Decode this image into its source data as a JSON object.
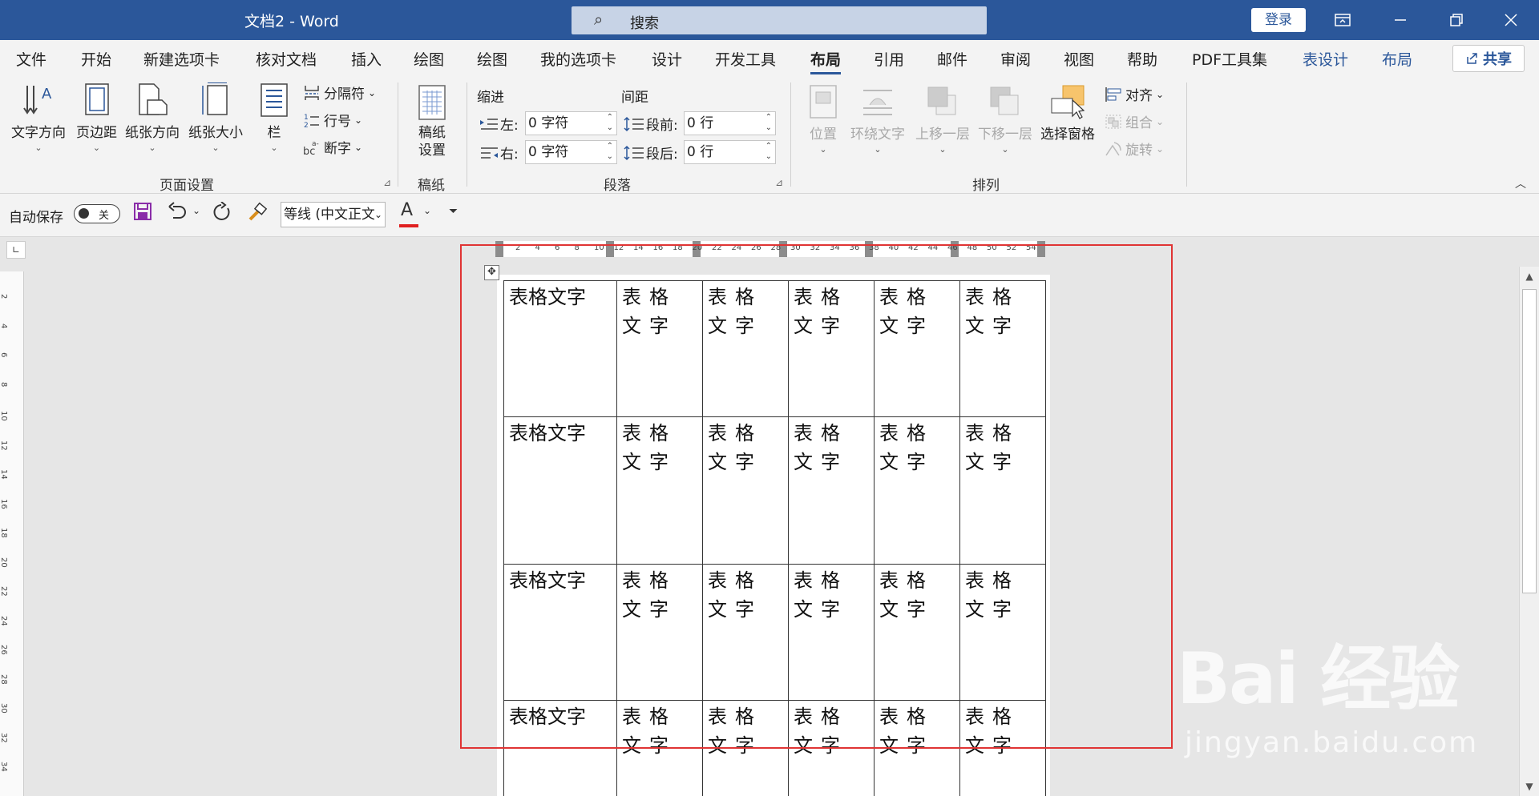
{
  "titlebar": {
    "title": "文档2  -  Word",
    "search_placeholder": "搜索",
    "login": "登录",
    "icons": [
      "ribbon-display-icon",
      "minimize-icon",
      "restore-icon",
      "close-icon"
    ]
  },
  "tabs": [
    "文件",
    "开始",
    "新建选项卡",
    "核对文档",
    "插入",
    "绘图",
    "绘图",
    "我的选项卡",
    "设计",
    "开发工具",
    "布局",
    "引用",
    "邮件",
    "审阅",
    "视图",
    "帮助",
    "PDF工具集",
    "表设计",
    "布局"
  ],
  "active_tab": "布局",
  "share": "共享",
  "ribbon": {
    "page_setup": {
      "label": "页面设置",
      "text_direction": "文字方向",
      "margins": "页边距",
      "orientation": "纸张方向",
      "size": "纸张大小",
      "columns": "栏",
      "breaks": "分隔符",
      "line_numbers": "行号",
      "hyphenation": "断字"
    },
    "manuscript": {
      "label": "稿纸",
      "button": "稿纸\n设置",
      "button_l1": "稿纸",
      "button_l2": "设置"
    },
    "paragraph": {
      "label": "段落",
      "indent_title": "缩进",
      "spacing_title": "间距",
      "left_label": "左:",
      "left_value": "0 字符",
      "right_label": "右:",
      "right_value": "0 字符",
      "before_label": "段前:",
      "before_value": "0 行",
      "after_label": "段后:",
      "after_value": "0 行"
    },
    "arrange": {
      "label": "排列",
      "position": "位置",
      "wrap_text": "环绕文字",
      "bring_forward": "上移一层",
      "send_backward": "下移一层",
      "selection_pane": "选择窗格",
      "align": "对齐",
      "group": "组合",
      "rotate": "旋转"
    }
  },
  "qat": {
    "autosave_label": "自动保存",
    "autosave_state": "关",
    "font_name": "等线 (中文正文)",
    "font_color": "#e02020"
  },
  "ruler": {
    "h_ticks": [
      "2",
      "4",
      "6",
      "8",
      "10",
      "12",
      "14",
      "16",
      "18",
      "20",
      "22",
      "24",
      "26",
      "28",
      "30",
      "32",
      "34",
      "36",
      "38",
      "40",
      "42",
      "44",
      "46",
      "48",
      "50",
      "52",
      "54"
    ],
    "v_ticks": [
      "2",
      "4",
      "6",
      "8",
      "10",
      "12",
      "14",
      "16",
      "18",
      "20",
      "22",
      "24",
      "26",
      "28",
      "30",
      "32",
      "34"
    ]
  },
  "table": {
    "rows": [
      [
        "表格文字",
        "表格文字",
        "表格文字",
        "表格文字",
        "表格文字",
        "表格文字"
      ],
      [
        "表格文字",
        "表格文字",
        "表格文字",
        "表格文字",
        "表格文字",
        "表格文字"
      ],
      [
        "表格文字",
        "表格文字",
        "表格文字",
        "表格文字",
        "表格文字",
        "表格文字"
      ],
      [
        "表格文字",
        "表格文字",
        "表格文字",
        "表格文字",
        "表格文字",
        "表格文字"
      ]
    ]
  },
  "watermark": {
    "brand": "Bai 经验",
    "url": "jingyan.baidu.com"
  },
  "colors": {
    "titlebar": "#2b579a",
    "highlight_box": "#e03434",
    "accent": "#2b579a"
  }
}
